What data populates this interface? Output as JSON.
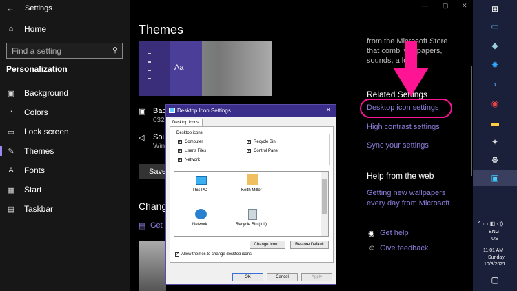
{
  "window": {
    "title": "Settings",
    "minimize": "—",
    "maximize": "▢",
    "close": "✕"
  },
  "sidebar": {
    "home": "Home",
    "search_placeholder": "Find a setting",
    "section": "Personalization",
    "items": [
      {
        "label": "Background",
        "icon": "picture-icon"
      },
      {
        "label": "Colors",
        "icon": "palette-icon"
      },
      {
        "label": "Lock screen",
        "icon": "monitor-icon"
      },
      {
        "label": "Themes",
        "icon": "brush-icon",
        "selected": true
      },
      {
        "label": "Fonts",
        "icon": "font-icon"
      },
      {
        "label": "Start",
        "icon": "grid-icon"
      },
      {
        "label": "Taskbar",
        "icon": "taskbar-icon"
      }
    ]
  },
  "main": {
    "title": "Themes",
    "preview_text": "Aa",
    "background_label": "Bac",
    "background_value": "032",
    "sound_label": "Sou",
    "sound_value": "Win",
    "save_button": "Save",
    "change_heading": "Chang",
    "get_link": "Get",
    "store_text": [
      "from the Microsoft Store",
      "that combi    wallpapers,",
      "sounds, a    lors"
    ],
    "related_heading": "Related Settings",
    "related_links": [
      "Desktop icon settings",
      "High contrast settings",
      "Sync your settings"
    ],
    "help_heading": "Help from the web",
    "help_link": "Getting new wallpapers every day from Microsoft",
    "get_help": "Get help",
    "give_feedback": "Give feedback"
  },
  "colors": {
    "accent": "#8a7ddb",
    "arrow": "#ff1493",
    "dialog_title": "#3a2e8a"
  },
  "dialog": {
    "title": "Desktop Icon Settings",
    "tab": "Desktop Icons",
    "group_label": "Desktop icons",
    "checks": [
      {
        "label": "Computer",
        "checked": true
      },
      {
        "label": "Recycle Bin",
        "checked": true
      },
      {
        "label": "User's Files",
        "checked": true
      },
      {
        "label": "Control Panel",
        "checked": true
      },
      {
        "label": "Network",
        "checked": true
      }
    ],
    "icons": [
      "This PC",
      "Keith Miller",
      "Network",
      "Recycle Bin (full)"
    ],
    "change_icon": "Change Icon...",
    "restore_default": "Restore Default",
    "allow_themes": "Allow themes to change desktop icons",
    "ok": "OK",
    "cancel": "Cancel",
    "apply": "Apply",
    "close": "✕"
  },
  "taskbar": {
    "lang1": "ENG",
    "lang2": "US",
    "time": "11:01 AM",
    "day": "Sunday",
    "date": "10/3/2021"
  }
}
